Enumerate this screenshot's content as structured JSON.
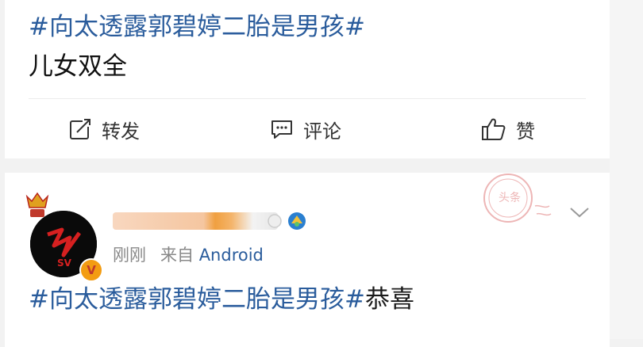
{
  "post1": {
    "topic_text": "#向太透露郭碧婷二胎是男孩#",
    "body_text": "儿女双全",
    "actions": {
      "repost_label": "转发",
      "comment_label": "评论",
      "like_label": "赞"
    }
  },
  "post2": {
    "meta": {
      "time": "刚刚",
      "source_prefix": "来自",
      "device": "Android"
    },
    "topic_text": "#向太透露郭碧婷二胎是男孩#",
    "trailing_text": "恭喜",
    "stamp_text": "头条",
    "avatar_logo": "SV"
  },
  "colors": {
    "hashtag": "#2a5c9c",
    "badge": "#f39c12",
    "crown": "#e0a020"
  },
  "icons": [
    "repost-icon",
    "comment-icon",
    "like-icon",
    "chevron-down-icon",
    "vip-crown-icon",
    "verified-badge-icon",
    "member-level-icon"
  ]
}
